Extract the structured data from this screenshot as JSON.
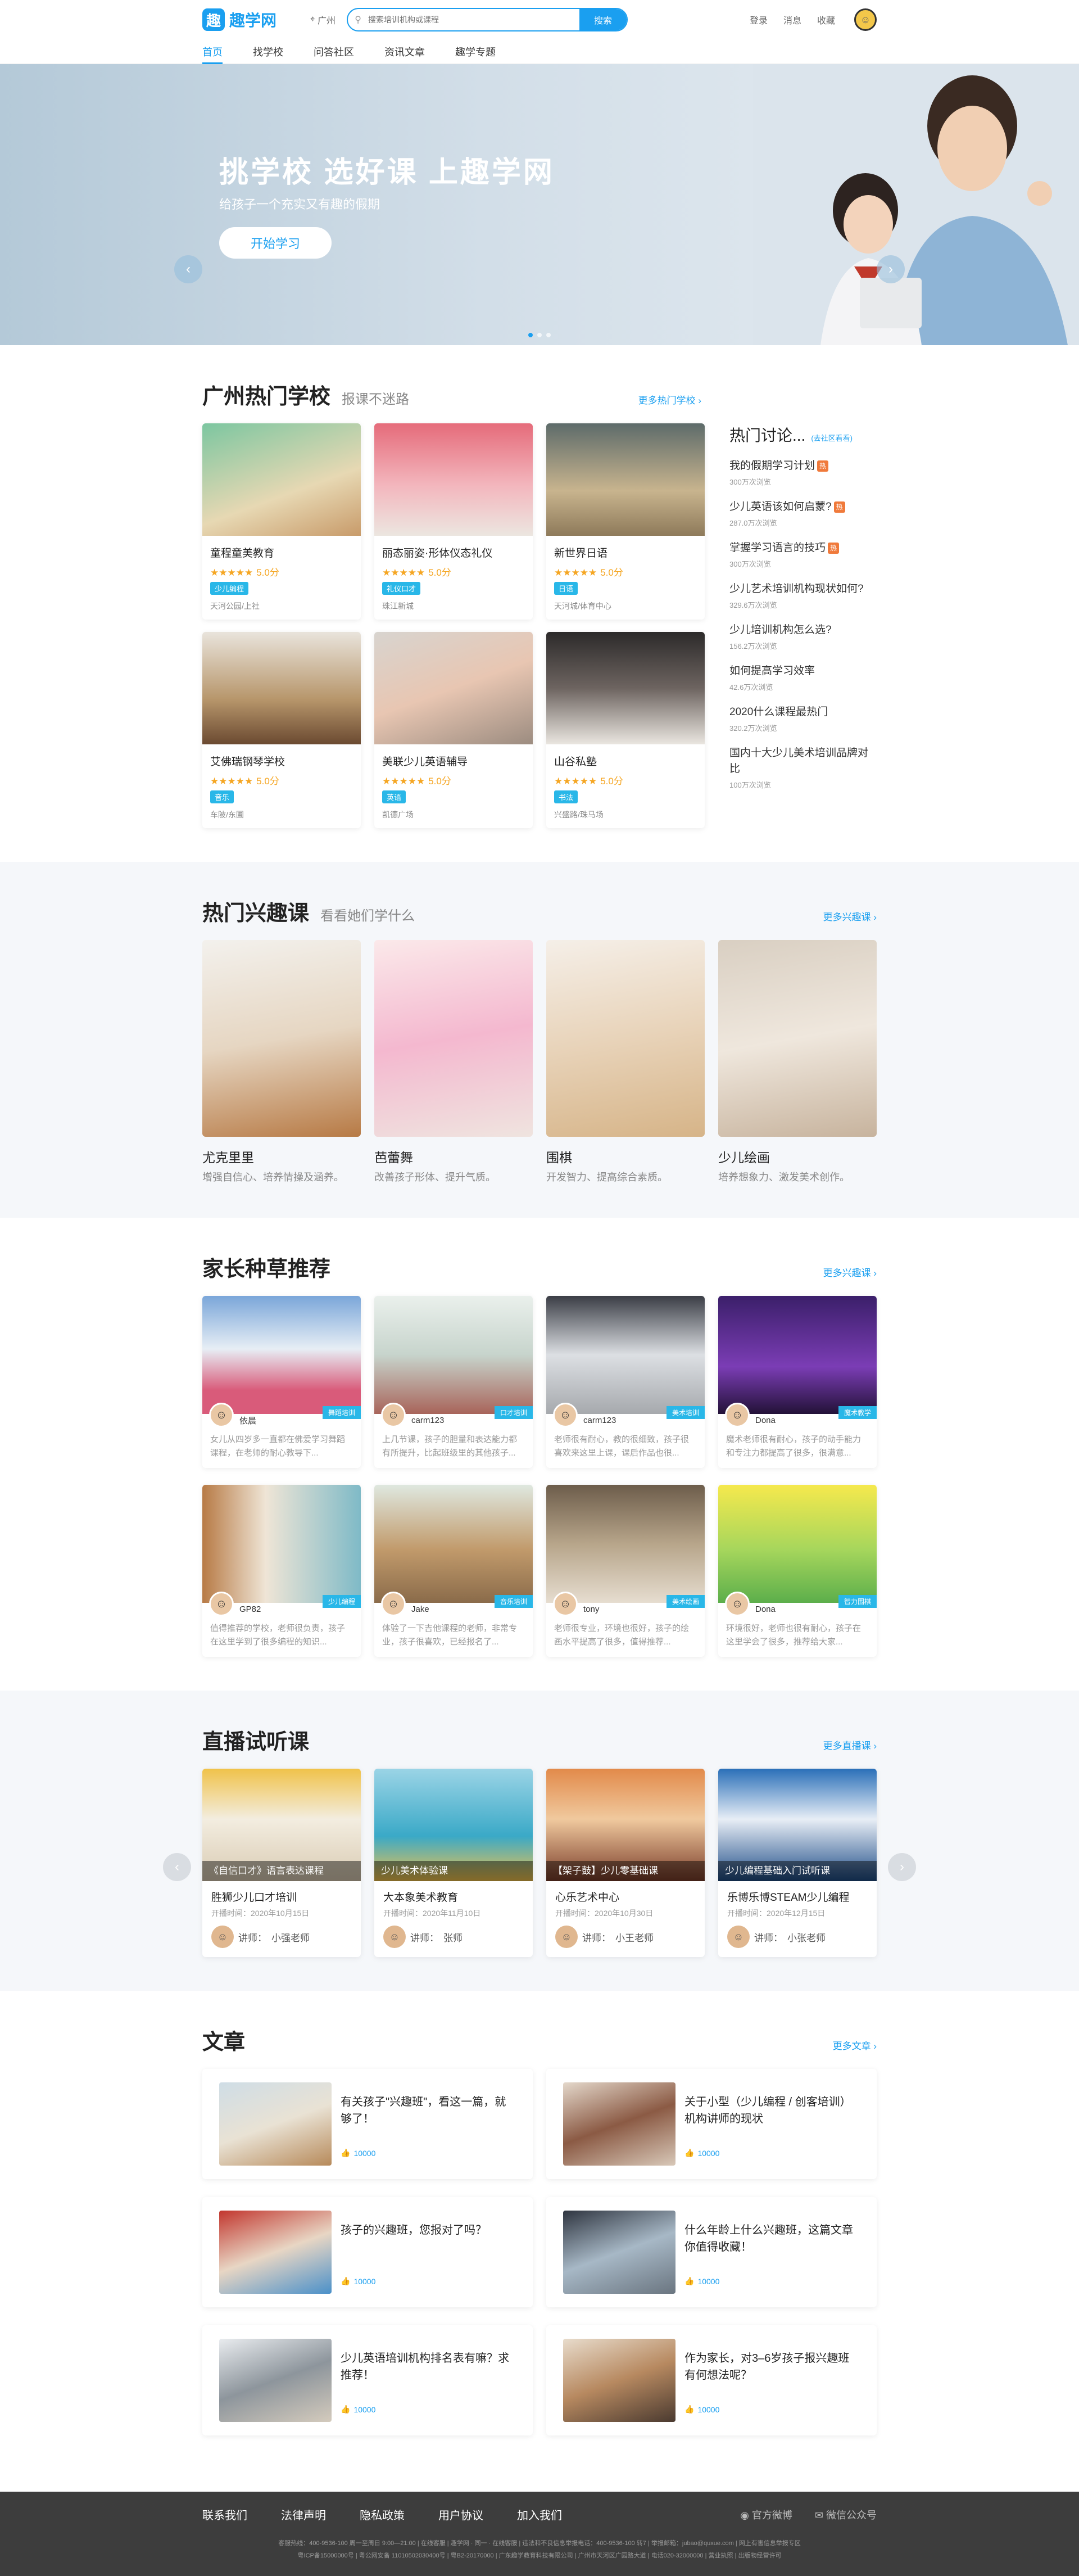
{
  "header": {
    "logo_mark": "趣",
    "logo_text": "趣学网",
    "city": "广州",
    "search_placeholder": "搜索培训机构或课程",
    "search_button": "搜索",
    "links": [
      "登录",
      "消息",
      "收藏"
    ]
  },
  "nav": [
    "首页",
    "找学校",
    "问答社区",
    "资讯文章",
    "趣学专题"
  ],
  "banner": {
    "title": "挑学校 选好课 上趣学网",
    "subtitle": "给孩子一个充实又有趣的假期",
    "button": "开始学习"
  },
  "hot_schools": {
    "title": "广州热门学校",
    "subtitle": "报课不迷路",
    "more": "更多热门学校 ›",
    "schools": [
      {
        "name": "童程童美教育",
        "score": "5.0分",
        "tag": "少儿编程",
        "addr": "天河公园/上社",
        "stars": "★★★★★"
      },
      {
        "name": "丽态丽姿·形体仪态礼仪",
        "score": "5.0分",
        "tag": "礼仪口才",
        "addr": "珠江新城",
        "stars": "★★★★★"
      },
      {
        "name": "新世界日语",
        "score": "5.0分",
        "tag": "日语",
        "addr": "天河城/体育中心",
        "stars": "★★★★★"
      },
      {
        "name": "艾佛瑞钢琴学校",
        "score": "5.0分",
        "tag": "音乐",
        "addr": "车陂/东圃",
        "stars": "★★★★★"
      },
      {
        "name": "美联少儿英语辅导",
        "score": "5.0分",
        "tag": "英语",
        "addr": "凯德广场",
        "stars": "★★★★★"
      },
      {
        "name": "山谷私塾",
        "score": "5.0分",
        "tag": "书法",
        "addr": "兴盛路/珠马场",
        "stars": "★★★★★"
      }
    ]
  },
  "discussion": {
    "title": "热门讨论...",
    "more": "(去社区看看)",
    "items": [
      {
        "q": "我的假期学习计划",
        "views": "300万次浏览",
        "hot": true
      },
      {
        "q": "少儿英语该如何启蒙?",
        "views": "287.0万次浏览",
        "hot": true
      },
      {
        "q": "掌握学习语言的技巧",
        "views": "300万次浏览",
        "hot": true
      },
      {
        "q": "少儿艺术培训机构现状如何?",
        "views": "329.6万次浏览",
        "hot": false
      },
      {
        "q": "少儿培训机构怎么选?",
        "views": "156.2万次浏览",
        "hot": false
      },
      {
        "q": "如何提高学习效率",
        "views": "42.6万次浏览",
        "hot": false
      },
      {
        "q": "2020什么课程最热门",
        "views": "320.2万次浏览",
        "hot": false
      },
      {
        "q": "国内十大少儿美术培训品牌对比",
        "views": "100万次浏览",
        "hot": false
      }
    ],
    "hot_label": "热"
  },
  "interest": {
    "title": "热门兴趣课",
    "subtitle": "看看她们学什么",
    "more": "更多兴趣课 ›",
    "courses": [
      {
        "name": "尤克里里",
        "desc": "增强自信心、培养情操及涵养。"
      },
      {
        "name": "芭蕾舞",
        "desc": "改善孩子形体、提升气质。"
      },
      {
        "name": "围棋",
        "desc": "开发智力、提高综合素质。"
      },
      {
        "name": "少儿绘画",
        "desc": "培养想象力、激发美术创作。"
      }
    ]
  },
  "recommend": {
    "title": "家长种草推荐",
    "more": "更多兴趣课 ›",
    "items": [
      {
        "user": "依晨",
        "tag": "舞蹈培训",
        "text": "女儿从四岁多一直都在佛爱学习舞蹈课程，在老师的耐心教导下..."
      },
      {
        "user": "carm123",
        "tag": "口才培训",
        "text": "上几节课，孩子的胆量和表达能力都有所提升，比起班级里的其他孩子..."
      },
      {
        "user": "carm123",
        "tag": "美术培训",
        "text": "老师很有耐心，教的很细致，孩子很喜欢来这里上课，课后作品也很..."
      },
      {
        "user": "Dona",
        "tag": "魔术教学",
        "text": "魔术老师很有耐心，孩子的动手能力和专注力都提高了很多，很满意..."
      },
      {
        "user": "GP82",
        "tag": "少儿编程",
        "text": "值得推荐的学校，老师很负责，孩子在这里学到了很多编程的知识..."
      },
      {
        "user": "Jake",
        "tag": "音乐培训",
        "text": "体验了一下吉他课程的老师，非常专业，孩子很喜欢，已经报名了..."
      },
      {
        "user": "tony",
        "tag": "美术绘画",
        "text": "老师很专业，环境也很好，孩子的绘画水平提高了很多，值得推荐..."
      },
      {
        "user": "Dona",
        "tag": "智力围棋",
        "text": "环境很好，老师也很有耐心，孩子在这里学会了很多，推荐给大家..."
      }
    ]
  },
  "live": {
    "title": "直播试听课",
    "more": "更多直播课 ›",
    "teacher_label": "讲师：",
    "courses": [
      {
        "caption": "《自信口才》语言表达课程",
        "name": "胜狮少儿口才培训",
        "time": "开播时间：2020年10月15日",
        "teacher": "小强老师"
      },
      {
        "caption": "少儿美术体验课",
        "name": "大本象美术教育",
        "time": "开播时间：2020年11月10日",
        "teacher": "张师"
      },
      {
        "caption": "【架子鼓】少儿零基础课",
        "name": "心乐艺术中心",
        "time": "开播时间：2020年10月30日",
        "teacher": "小王老师"
      },
      {
        "caption": "少儿编程基础入门试听课",
        "name": "乐博乐博STEAM少儿编程",
        "time": "开播时间：2020年12月15日",
        "teacher": "小张老师"
      }
    ]
  },
  "articles": {
    "title": "文章",
    "more": "更多文章 ›",
    "items": [
      {
        "title": "有关孩子\"兴趣班\"，看这一篇，就够了！",
        "likes": "10000"
      },
      {
        "title": "关于小型（少儿编程 / 创客培训）机构讲师的现状",
        "likes": "10000"
      },
      {
        "title": "孩子的兴趣班，您报对了吗？",
        "likes": "10000"
      },
      {
        "title": "什么年龄上什么兴趣班，这篇文章你值得收藏！",
        "likes": "10000"
      },
      {
        "title": "少儿英语培训机构排名表有嘛？求推荐！",
        "likes": "10000"
      },
      {
        "title": "作为家长，对3–6岁孩子报兴趣班有何想法呢？",
        "likes": "10000"
      }
    ]
  },
  "footer": {
    "links": [
      "联系我们",
      "法律声明",
      "隐私政策",
      "用户协议",
      "加入我们"
    ],
    "social": [
      "官方微博",
      "微信公众号"
    ],
    "line1": "客服热线：400-9536-100 周一至周日 9:00—21:00 | 在线客服 | 趣学网 · 同一 · 在线客服 | 违法和不良信息举报电话：400-9536-100 转7 | 举报邮箱：jubao@quxue.com | 网上有害信息举报专区",
    "line2": "粤ICP备15000000号 | 粤公网安备 11010502030400号 | 粤B2-20170000 | 广东趣学教育科技有限公司 | 广州市天河区广园路大道 | 电话020-32000000 | 营业执照 | 出版物经营许可"
  },
  "colors": {
    "brand": "#1a9ff0",
    "tag": "#29b7e8",
    "star": "#f5a623",
    "footer_bg": "#3d3d3d"
  }
}
